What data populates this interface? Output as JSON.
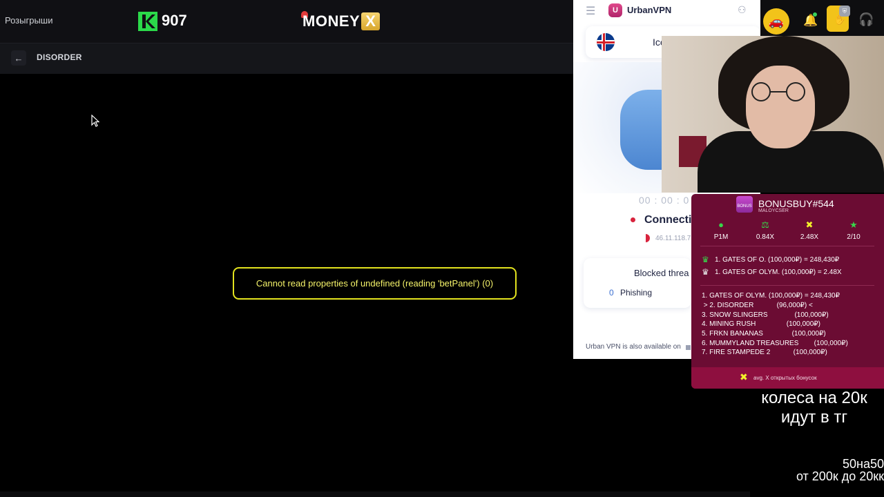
{
  "topbar": {
    "raffles_label": "Розыгрыши",
    "k_count": "907",
    "brand_main": "MONEY",
    "brand_x": "X"
  },
  "game": {
    "back_icon": "←",
    "title": "DISORDER",
    "error": "Cannot read properties of undefined (reading 'betPanel') (0)"
  },
  "vpn": {
    "menu_icon": "☰",
    "logo_letter": "U",
    "name": "UrbanVPN",
    "profile_icon": "⚇",
    "country": "Ice",
    "timer": "00 : 00 : 0",
    "status": "Connecti",
    "ip": "46.11.118.7",
    "blocked_title": "Blocked threa",
    "phishing_count": "0",
    "phishing_label": "Phishing",
    "footer": "Urban VPN is also available on"
  },
  "toolbar": {
    "car_icon": "🚗",
    "bell_icon": "🔔",
    "ext_icon": "✋",
    "ext_badge": "⛨",
    "headset_icon": "🎧"
  },
  "bonusbuy": {
    "icon_label": "BONUS",
    "title": "BONUSBUY#544",
    "subtitle": "MALOYCSER",
    "stats": [
      {
        "icon": "●",
        "color": "#38d64a",
        "value": "P1M"
      },
      {
        "icon": "⚖",
        "color": "#38d64a",
        "value": "0.84X"
      },
      {
        "icon": "✖",
        "color": "#f2f22a",
        "value": "2.48X"
      },
      {
        "icon": "★",
        "color": "#38d64a",
        "value": "2/10"
      }
    ],
    "best_lines": [
      {
        "icon": "♛",
        "color": "#38d64a",
        "text": "1. GATES OF O. (100,000₽) = 248,430₽"
      },
      {
        "icon": "♛",
        "color": "#e8e8e8",
        "text": "1. GATES OF OLYM. (100,000₽) = 2.48X"
      }
    ],
    "list": [
      "1. GATES OF OLYM. (100,000₽) = 248,430₽",
      " > 2. DISORDER            (96,000₽) <",
      "3. SNOW SLINGERS              (100,000₽)",
      "4. MINING RUSH                (100,000₽)",
      "5. FRKN BANANAS               (100,000₽)",
      "6. MUMMYLAND TREASURES        (100,000₽)",
      "7. FIRE STAMPEDE 2            (100,000₽)"
    ],
    "footer_icon": "✖",
    "footer_text": "avg. X открытых бонусок"
  },
  "overlay": {
    "wheels_line1": "колеса на 20к",
    "wheels_line2": "идут в тг",
    "promo1": "50на50",
    "promo2": "от 200к до 20кк"
  }
}
